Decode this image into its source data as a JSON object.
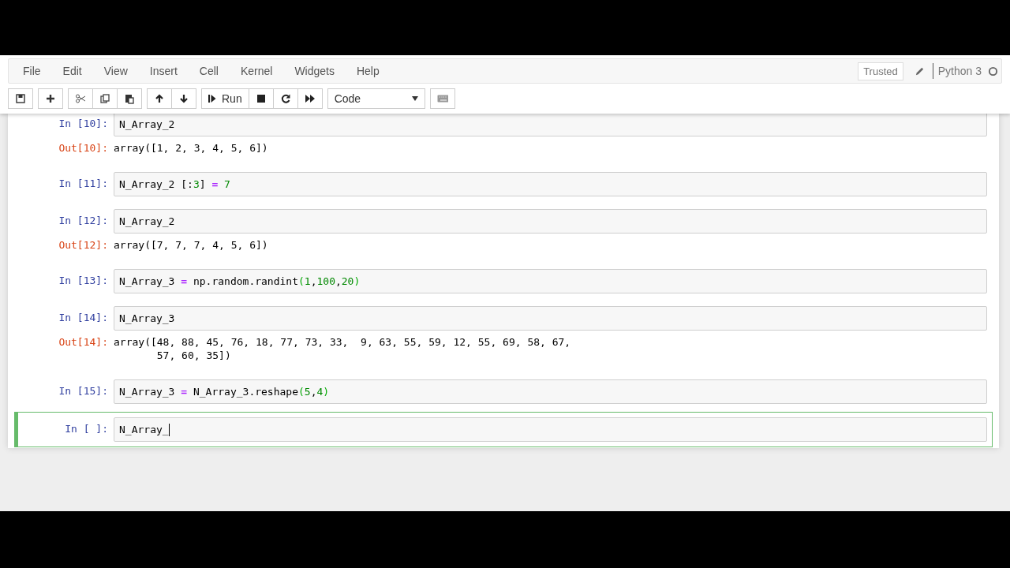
{
  "menu": [
    "File",
    "Edit",
    "View",
    "Insert",
    "Cell",
    "Kernel",
    "Widgets",
    "Help"
  ],
  "status": {
    "trusted": "Trusted",
    "kernel": "Python 3"
  },
  "toolbar": {
    "run": "Run",
    "cell_type": "Code"
  },
  "cells": [
    {
      "prompt": "In [10]:",
      "selected": false,
      "code": [
        {
          "kind": "name",
          "text": "N_Array_2"
        }
      ],
      "out_prompt": "Out[10]:",
      "output": [
        "array([1, 2, 3, 4, 5, 6])"
      ]
    },
    {
      "prompt": "In [11]:",
      "selected": false,
      "code": [
        {
          "kind": "name",
          "text": "N_Array_2 [:"
        },
        {
          "kind": "num",
          "text": "3"
        },
        {
          "kind": "name",
          "text": "] "
        },
        {
          "kind": "op",
          "text": "= "
        },
        {
          "kind": "num",
          "text": "7"
        }
      ]
    },
    {
      "prompt": "In [12]:",
      "selected": false,
      "code": [
        {
          "kind": "name",
          "text": "N_Array_2"
        }
      ],
      "out_prompt": "Out[12]:",
      "output": [
        "array([7, 7, 7, 4, 5, 6])"
      ]
    },
    {
      "prompt": "In [13]:",
      "selected": false,
      "code": [
        {
          "kind": "name",
          "text": "N_Array_3 "
        },
        {
          "kind": "op",
          "text": "="
        },
        {
          "kind": "name",
          "text": " np.random.randint"
        },
        {
          "kind": "paren",
          "text": "("
        },
        {
          "kind": "num",
          "text": "1"
        },
        {
          "kind": "name",
          "text": ","
        },
        {
          "kind": "num",
          "text": "100"
        },
        {
          "kind": "name",
          "text": ","
        },
        {
          "kind": "num",
          "text": "20"
        },
        {
          "kind": "paren",
          "text": ")"
        }
      ]
    },
    {
      "prompt": "In [14]:",
      "selected": false,
      "code": [
        {
          "kind": "name",
          "text": "N_Array_3"
        }
      ],
      "out_prompt": "Out[14]:",
      "output": [
        "array([48, 88, 45, 76, 18, 77, 73, 33,  9, 63, 55, 59, 12, 55, 69, 58, 67,",
        "       57, 60, 35])"
      ]
    },
    {
      "prompt": "In [15]:",
      "selected": false,
      "code": [
        {
          "kind": "name",
          "text": "N_Array_3 "
        },
        {
          "kind": "op",
          "text": "="
        },
        {
          "kind": "name",
          "text": " N_Array_3.reshape"
        },
        {
          "kind": "paren",
          "text": "("
        },
        {
          "kind": "num",
          "text": "5"
        },
        {
          "kind": "name",
          "text": ","
        },
        {
          "kind": "num",
          "text": "4"
        },
        {
          "kind": "paren",
          "text": ")"
        }
      ]
    },
    {
      "prompt": "In [ ]:",
      "selected": true,
      "code": [
        {
          "kind": "name",
          "text": "N_Array_"
        }
      ]
    }
  ]
}
